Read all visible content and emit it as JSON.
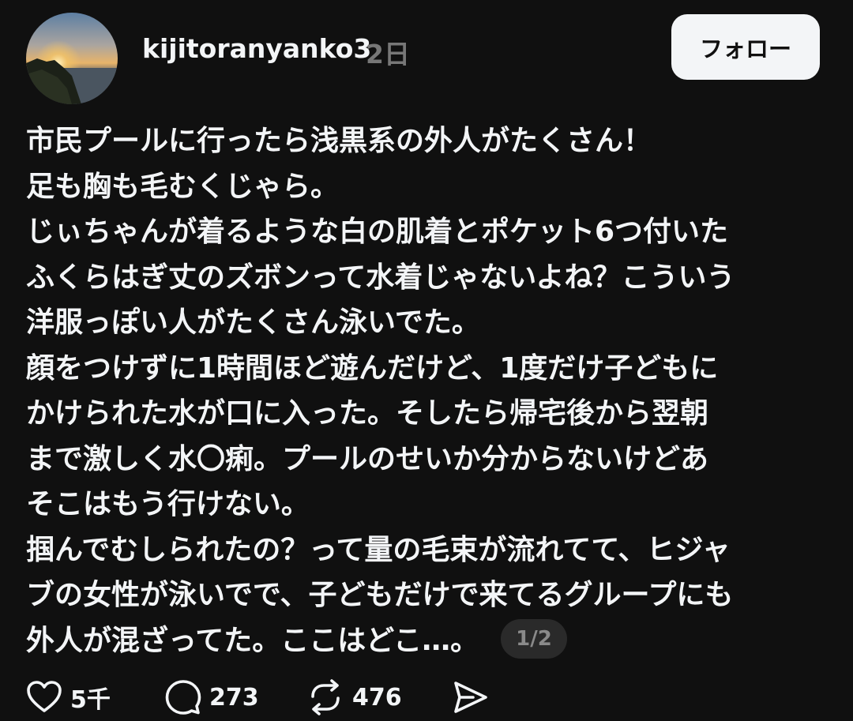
{
  "post": {
    "author": {
      "username": "kijitoranyanko3",
      "timestamp": "2日",
      "avatar_icon": "sunset-landscape-avatar"
    },
    "follow_label": "フォロー",
    "lines": [
      "市民プールに行ったら浅黒系の外人がたくさん！",
      "足も胸も毛むくじゃら。",
      "じぃちゃんが着るような白の肌着とポケット6つ付いた",
      "ふくらはぎ丈のズボンって水着じゃないよね？こういう",
      "洋服っぽい人がたくさん泳いでた。",
      "顔をつけずに1時間ほど遊んだけど、1度だけ子どもに",
      "かけられた水が口に入った。そしたら帰宅後から翌朝",
      "まで激しく水〇痢。プールのせいか分からないけどあ",
      "そこはもう行けない。",
      "掴んでむしられたの？って量の毛束が流れてて、ヒジャ",
      "ブの女性が泳いでで、子どもだけで来てるグループにも",
      "外人が混ざってた。ここはどこ…。"
    ],
    "page_counter": "1/2",
    "actions": {
      "likes": {
        "icon": "heart-icon",
        "count": "5千"
      },
      "replies": {
        "icon": "comment-icon",
        "count": "273"
      },
      "reposts": {
        "icon": "repost-icon",
        "count": "476"
      },
      "share": {
        "icon": "share-icon"
      }
    }
  },
  "colors": {
    "background": "#101010",
    "text_primary": "#f3f5f7",
    "text_secondary": "#777777",
    "button_bg": "#f3f5f7",
    "button_text": "#101010"
  }
}
